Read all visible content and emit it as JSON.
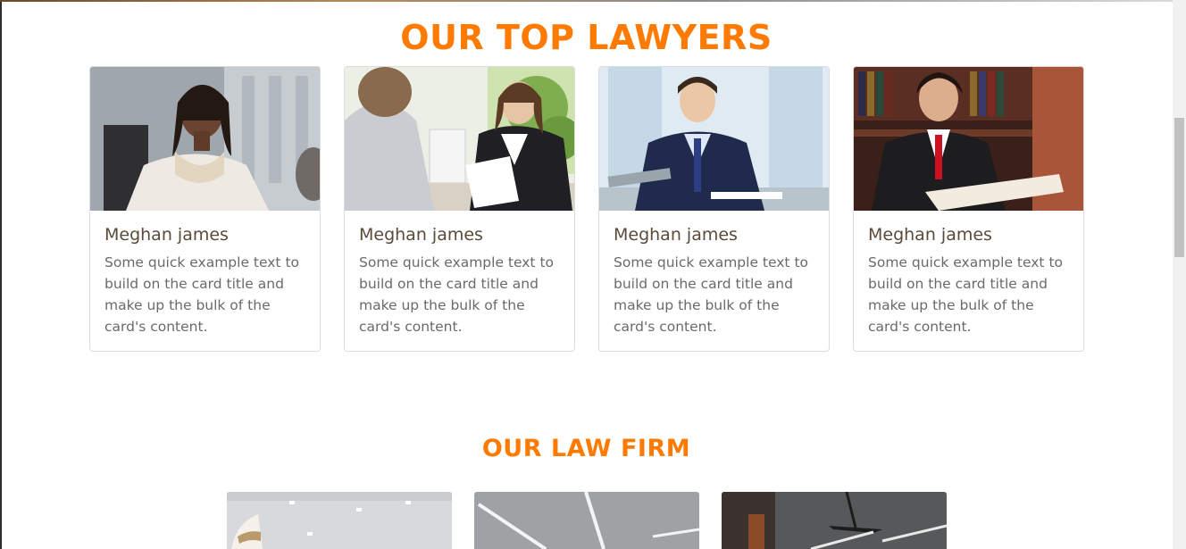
{
  "sections": {
    "lawyers_title": "OUR TOP LAWYERS",
    "firm_title": "OUR LAW FIRM"
  },
  "lawyers": [
    {
      "name": "Meghan james",
      "text": "Some quick example text to build on the card title and make up the bulk of the card's content."
    },
    {
      "name": "Meghan james",
      "text": "Some quick example text to build on the card title and make up the bulk of the card's content."
    },
    {
      "name": "Meghan james",
      "text": "Some quick example text to build on the card title and make up the bulk of the card's content."
    },
    {
      "name": "Meghan james",
      "text": "Some quick example text to build on the card title and make up the bulk of the card's content."
    }
  ],
  "colors": {
    "accent": "#ff7a00",
    "card_title": "#5a4a3a",
    "card_text": "#6a6a6a",
    "card_border": "#dcdcdc"
  }
}
